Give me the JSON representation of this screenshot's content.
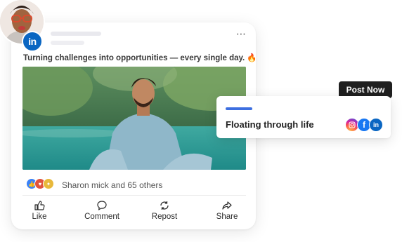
{
  "post": {
    "caption": "Turning challenges into opportunities — every single day. 🔥",
    "more_icon": "⋯",
    "badge_text": "in",
    "reactions_text": "Sharon mick and 65 others",
    "actions": [
      {
        "label": "Like"
      },
      {
        "label": "Comment"
      },
      {
        "label": "Repost"
      },
      {
        "label": "Share"
      }
    ]
  },
  "scheduler": {
    "button_label": "Post Now",
    "title": "Floating through life"
  },
  "colors": {
    "linkedin": "#0a66c2",
    "facebook": "#1877f2",
    "accent_bar": "#3d6fe0"
  }
}
